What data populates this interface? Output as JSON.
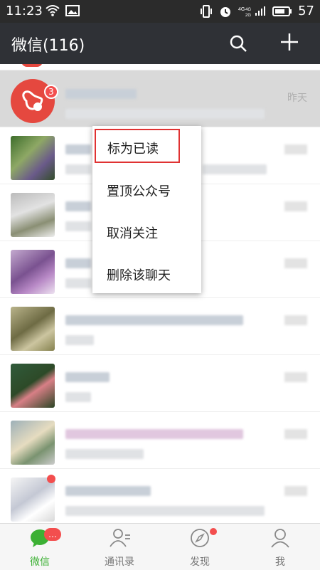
{
  "status_bar": {
    "time": "11:23",
    "battery_level": "57",
    "icons": [
      "wifi-icon",
      "image-icon",
      "vibrate-icon",
      "alarm-icon",
      "network-4g-icon",
      "signal-icon",
      "battery-icon"
    ]
  },
  "header": {
    "title": "微信(116)",
    "icons": [
      "search-icon",
      "plus-icon"
    ]
  },
  "chats": [
    {
      "unread": "3",
      "time": "昨天"
    },
    {
      "unread": ""
    },
    {
      "unread": ""
    },
    {
      "unread": ""
    },
    {
      "unread": ""
    },
    {
      "unread": ""
    },
    {
      "unread": ""
    },
    {
      "unread": ""
    }
  ],
  "context_menu": {
    "items": [
      "标为已读",
      "置顶公众号",
      "取消关注",
      "删除该聊天"
    ]
  },
  "tabs": [
    {
      "label": "微信",
      "badge": "…"
    },
    {
      "label": "通讯录"
    },
    {
      "label": "发现"
    },
    {
      "label": "我"
    }
  ],
  "colors": {
    "accent_green": "#3cb034",
    "badge_red": "#f34e4e",
    "header_bg": "#2f3136",
    "menu_highlight_border": "#e03232"
  }
}
